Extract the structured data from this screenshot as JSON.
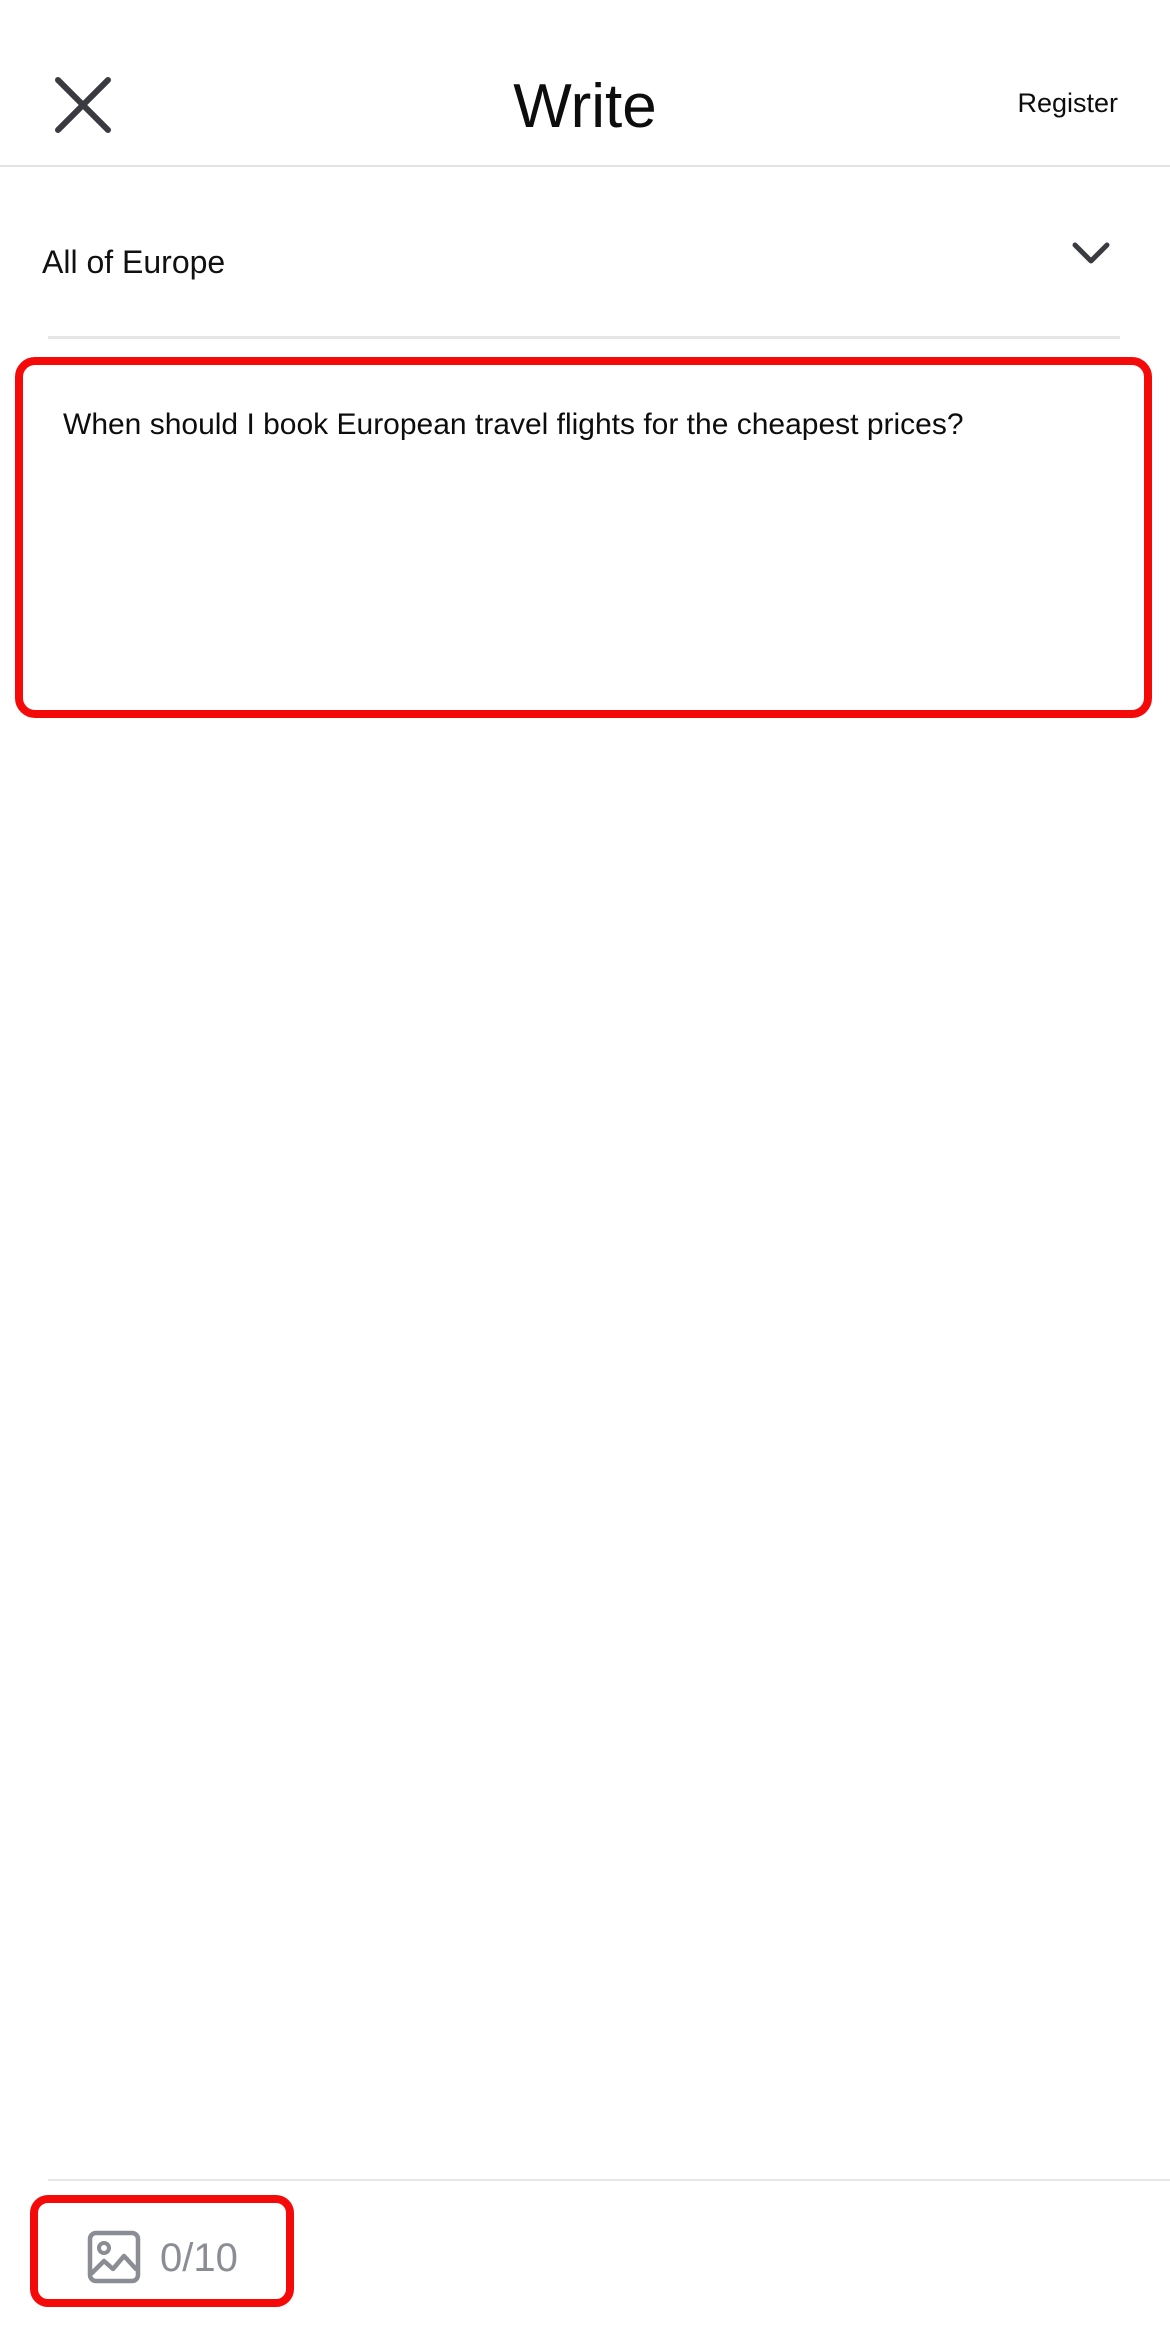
{
  "header": {
    "title": "Write",
    "register_label": "Register",
    "close_icon": "close-icon"
  },
  "region": {
    "selected": "All of Europe",
    "dropdown_icon": "chevron-down-icon"
  },
  "editor": {
    "text": "When should I book European travel flights for the cheapest prices?"
  },
  "attachments": {
    "icon": "image-icon",
    "count": "0/10"
  },
  "colors": {
    "highlight": "#f50a0a",
    "icon_dark": "#3a3b40",
    "icon_gray": "#8a8d93",
    "divider": "#e6e6e9"
  }
}
